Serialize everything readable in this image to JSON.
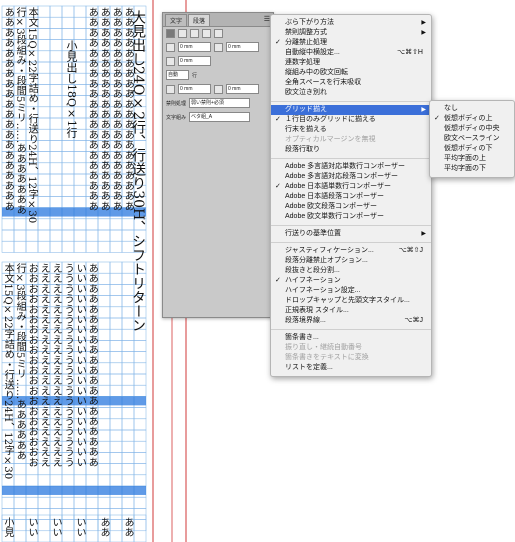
{
  "document": {
    "headline": "大見出し24Q×2行、行送り30H、シフトリターン",
    "headline_highlight": "ー",
    "subhead": "小見出し18Q×1行",
    "body_top_lines": [
      "本文15Q×22字詰め・行送り24H、12字×30",
      "行×3段組み・段間5ミリ……あああああああ",
      "ああああああああああああああああああああ",
      "ああああああああああああああああああああ",
      "ああああああああああああああああああああ",
      "ああああああああああああああああああああ",
      "ああああああああああああああああああああ"
    ],
    "body_bottom_lines": [
      "本文15Q×22字詰め・行送り24H、12字×30",
      "行×3段組み・段間5ミリ……ああああああ",
      "おおおおおおおおおおおおおおおおおおおお",
      "ええええええええええええええええええええ",
      "ええええええええええええええええええええ",
      "うううううううううううううううううううう",
      "いいいいいいいいいいいいいいいいいいいい",
      "ああああああああああああああああああああ"
    ],
    "bottom_labels": [
      "小見",
      "いい",
      "いい",
      "いい",
      "ああ",
      "ああ"
    ]
  },
  "panel": {
    "tabs": [
      "文字",
      "段落"
    ],
    "active_tab": "段落",
    "indent_values": [
      "0 mm",
      "0 mm",
      "0 mm"
    ],
    "space_values": [
      "0 mm",
      "0 mm"
    ],
    "auto_label": "自動",
    "gyou_label": "行",
    "kinsoku_label": "禁則処理",
    "kinsoku_value": "弱い禁則+必須",
    "mojikumi_label": "文字組み",
    "mojikumi_value": "ベタ組_A"
  },
  "main_menu": {
    "items": [
      {
        "label": "ぶら下がり方法",
        "arrow": true
      },
      {
        "label": "禁則調整方式",
        "arrow": true
      },
      {
        "label": "分離禁止処理",
        "check": true
      },
      {
        "label": "自動縦中横設定...",
        "shortcut": "⌥⌘⇧H"
      },
      {
        "label": "連数字処理"
      },
      {
        "label": "縦組み中の欧文回転"
      },
      {
        "label": "全角スペースを行末吸収"
      },
      {
        "label": "欧文泣き別れ"
      },
      {
        "sep": true
      },
      {
        "label": "グリッド揃え",
        "arrow": true,
        "highlight": true
      },
      {
        "label": "１行目のみグリッドに揃える",
        "check": true
      },
      {
        "label": "行末を揃える"
      },
      {
        "label": "オプティカルマージンを無視",
        "disabled": true
      },
      {
        "label": "段落行取り"
      },
      {
        "sep": true
      },
      {
        "label": "Adobe 多言語対応単数行コンポーザー"
      },
      {
        "label": "Adobe 多言語対応段落コンポーザー"
      },
      {
        "label": "Adobe 日本語単数行コンポーザー",
        "check": true
      },
      {
        "label": "Adobe 日本語段落コンポーザー"
      },
      {
        "label": "Adobe 欧文段落コンポーザー"
      },
      {
        "label": "Adobe 欧文単数行コンポーザー"
      },
      {
        "sep": true
      },
      {
        "label": "行送りの基準位置",
        "arrow": true
      },
      {
        "sep": true
      },
      {
        "label": "ジャスティフィケーション...",
        "shortcut": "⌥⌘⇧J"
      },
      {
        "label": "段落分離禁止オプション..."
      },
      {
        "label": "段抜きと段分割..."
      },
      {
        "label": "ハイフネーション",
        "check": true
      },
      {
        "label": "ハイフネーション設定..."
      },
      {
        "label": "ドロップキャップと先頭文字スタイル..."
      },
      {
        "label": "正規表現 スタイル..."
      },
      {
        "label": "段落境界線...",
        "shortcut": "⌥⌘J"
      },
      {
        "sep": true
      },
      {
        "label": "箇条書き..."
      },
      {
        "label": "振り直し・継続自動番号",
        "disabled": true
      },
      {
        "label": "箇条書きをテキストに変換",
        "disabled": true
      },
      {
        "label": "リストを定義..."
      }
    ]
  },
  "sub_menu": {
    "items": [
      {
        "label": "なし"
      },
      {
        "label": "仮想ボディの上",
        "check": true
      },
      {
        "label": "仮想ボディの中央"
      },
      {
        "label": "欧文ベースライン"
      },
      {
        "label": "仮想ボディの下"
      },
      {
        "label": "平均字面の上"
      },
      {
        "label": "平均字面の下"
      }
    ]
  },
  "colors": {
    "grid": "#7fb3e6",
    "grid_line_highlight": "#2a78df",
    "margin_line": "#d23a3a",
    "menu_highlight": "#3b6fd9",
    "text_highlight": "#ffd23a"
  }
}
